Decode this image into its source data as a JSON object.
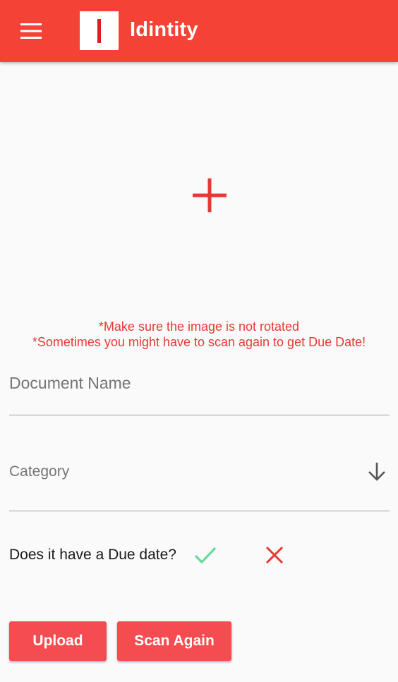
{
  "app": {
    "title": "Idintity",
    "accent_color": "#f44336",
    "logo_letter_color": "#e01b1b"
  },
  "header": {
    "menu_icon": "hamburger-menu-icon",
    "logo_icon": "idintity-logo-icon"
  },
  "image_picker": {
    "icon": "plus-icon"
  },
  "hints": {
    "line1": "*Make sure the image is not rotated",
    "line2": "*Sometimes you might have to scan again to get Due Date!"
  },
  "form": {
    "document_name": {
      "placeholder": "Document Name",
      "value": ""
    },
    "category": {
      "label": "Category",
      "icon": "arrow-down-icon"
    },
    "due_date": {
      "question": "Does it have a Due date?",
      "yes_icon": "check-icon",
      "no_icon": "close-icon",
      "yes_color": "#69d99a",
      "no_color": "#e53935"
    }
  },
  "actions": {
    "upload_label": "Upload",
    "scan_again_label": "Scan Again",
    "button_color": "#f44c50"
  }
}
